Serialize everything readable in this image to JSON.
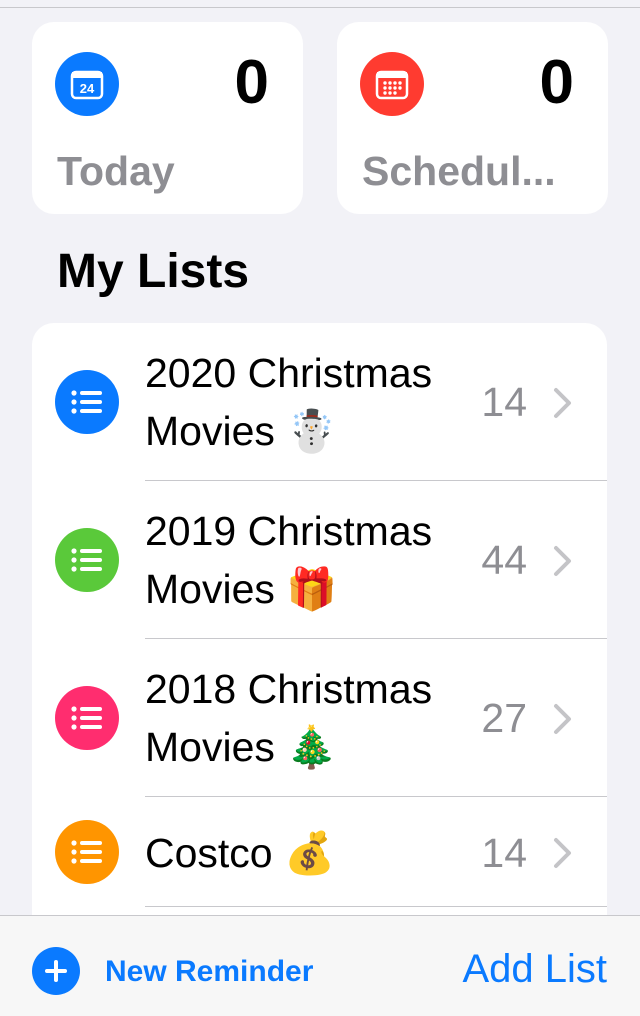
{
  "colors": {
    "accent": "#0a7aff",
    "today_icon": "#0a7aff",
    "scheduled_icon": "#ff3b30",
    "list_blue": "#0a7aff",
    "list_green": "#5ac93a",
    "list_pink": "#ff2d6f",
    "list_orange": "#ff9500"
  },
  "smart_lists": {
    "today": {
      "label": "Today",
      "count": "0",
      "icon": "calendar-day-icon",
      "day": "24"
    },
    "scheduled": {
      "label": "Schedul...",
      "count": "0",
      "icon": "calendar-grid-icon"
    }
  },
  "section_title": "My Lists",
  "lists": [
    {
      "line1": "2020 Christmas",
      "line2": "Movies ☃️",
      "count": "14",
      "icon": "list-bullet-icon",
      "color": "#0a7aff"
    },
    {
      "line1": "2019 Christmas",
      "line2": "Movies 🎁",
      "count": "44",
      "icon": "list-bullet-icon",
      "color": "#5ac93a"
    },
    {
      "line1": "2018 Christmas",
      "line2": "Movies 🎄",
      "count": "27",
      "icon": "list-bullet-icon",
      "color": "#ff2d6f"
    },
    {
      "line1": "Costco 💰",
      "line2": "",
      "count": "14",
      "icon": "list-bullet-icon",
      "color": "#ff9500"
    }
  ],
  "toolbar": {
    "new_reminder_label": "New Reminder",
    "add_list_label": "Add List"
  }
}
